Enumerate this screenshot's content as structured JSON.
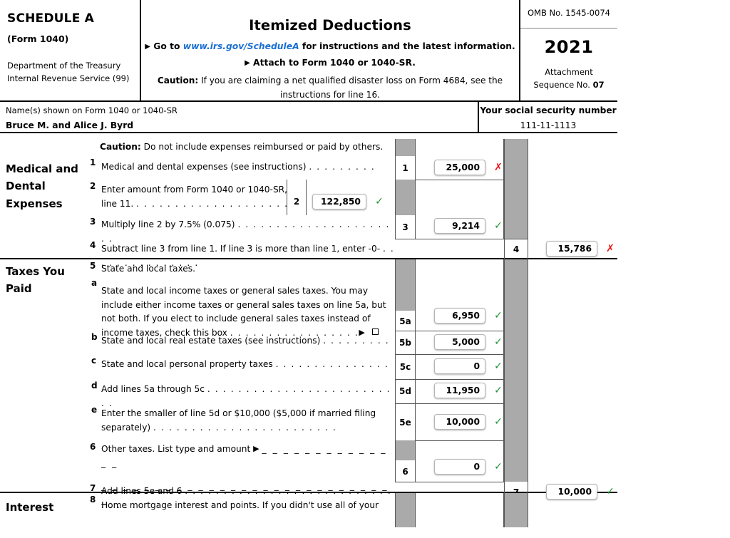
{
  "header": {
    "schedule": "SCHEDULE A",
    "form": "(Form 1040)",
    "dept_line1": "Department of the Treasury",
    "dept_line2": "Internal Revenue Service (99)",
    "title": "Itemized Deductions",
    "goto_prefix": "Go to",
    "goto_url": "www.irs.gov/ScheduleA",
    "goto_suffix": "for instructions and the latest information.",
    "attach_line": "Attach to Form 1040 or 1040-SR.",
    "caution_label": "Caution:",
    "caution_text": "If you are claiming a net qualified disaster loss on Form 4684, see the instructions for line 16.",
    "omb": "OMB No. 1545-0074",
    "year": "2021",
    "attachment_label": "Attachment",
    "sequence_label": "Sequence No.",
    "sequence_no": "07"
  },
  "taxpayer": {
    "name_label": "Name(s) shown on Form 1040 or 1040-SR",
    "name_value": "Bruce M. and Alice J. Byrd",
    "ssn_label": "Your social security number",
    "ssn_value": "111-11-1113"
  },
  "sections": [
    {
      "category": "Medical and Dental Expenses",
      "caution_label": "Caution:",
      "caution_text": "Do not include expenses reimbursed or paid by others.",
      "lines": [
        {
          "marker": "1",
          "text": "Medical and dental expenses (see instructions)",
          "dots": ". . . . . . . . .",
          "box_number": "1",
          "value": "25,000",
          "status": "bad"
        },
        {
          "marker": "2",
          "text": "Enter amount from Form 1040 or 1040-SR, line 11.",
          "dots": ". . . . . . . . . . . . . . . . . . . .",
          "inline_box_number": "2",
          "value": "122,850",
          "status": "ok"
        },
        {
          "marker": "3",
          "text": "Multiply line 2 by 7.5% (0.075)",
          "dots": ". . . . . . . . . . . . . . . . . . . . . .",
          "box_number": "3",
          "value": "9,214",
          "status": "ok"
        },
        {
          "marker": "4",
          "text": "Subtract line 3 from line 1. If line 3 is more than line 1, enter -0-",
          "dots": ". . . . . . . . . . . . . . .",
          "box_number_right": "4",
          "value": "15,786",
          "status": "bad"
        }
      ]
    },
    {
      "category": "Taxes You Paid",
      "lines": [
        {
          "marker": "5",
          "text": "State and local taxes."
        },
        {
          "marker": "a",
          "text": "State and local income taxes or general sales taxes. You may include either income taxes or general sales taxes on line 5a, but not both. If you elect to include general sales taxes instead of income taxes, check this box",
          "dots": ". . . . . . . . . . . . . . . . .",
          "has_arrow": true,
          "has_checkbox": true,
          "box_number": "5a",
          "value": "6,950",
          "status": "ok"
        },
        {
          "marker": "b",
          "text": "State and local real estate taxes (see instructions)",
          "dots": ". . . . . . . . .",
          "box_number": "5b",
          "value": "5,000",
          "status": "ok"
        },
        {
          "marker": "c",
          "text": "State and local personal property taxes",
          "dots": ". . . . . . . . . . . . . . .",
          "box_number": "5c",
          "value": "0",
          "status": "ok"
        },
        {
          "marker": "d",
          "text": "Add lines 5a through 5c",
          "dots": ". . . . . . . . . . . . . . . . . . . . . . . . . .",
          "box_number": "5d",
          "value": "11,950",
          "status": "ok"
        },
        {
          "marker": "e",
          "text": "Enter the smaller of line 5d or $10,000 ($5,000 if married filing separately)",
          "dots": ". . . . . . . . . . . . . . . . . . . . . . . .",
          "box_number": "5e",
          "value": "10,000",
          "status": "ok"
        },
        {
          "marker": "6",
          "text": "Other taxes. List type and amount",
          "has_arrow": true,
          "blank_line_1": "_ _ _ _ _ _ _ _ _ _ _ _ _ _",
          "blank_line_2": "_ _ _ _ _ _ _ _ _ _ _ _ _ _ _ _ _ _ _ _ _ _ _ _ _ _ _ _",
          "box_number": "6",
          "value": "0",
          "status": "ok"
        },
        {
          "marker": "7",
          "text": "Add lines 5e and 6",
          "dots": ". . . . . . . . . . . . . . . . . . . . . . . . . . . . . . . .",
          "box_number_right": "7",
          "value": "10,000",
          "status": "ok"
        }
      ]
    },
    {
      "category": "Interest",
      "lines": [
        {
          "marker": "8",
          "text": "Home mortgage interest and points. If you didn't use all of your"
        }
      ]
    }
  ],
  "icons": {
    "valid": "✓",
    "invalid": "✗",
    "arrow": "▶"
  },
  "colors": {
    "link": "#1a6fd4",
    "valid": "#1a9431",
    "invalid": "#ee1111",
    "shade": "#aaaaaa"
  }
}
